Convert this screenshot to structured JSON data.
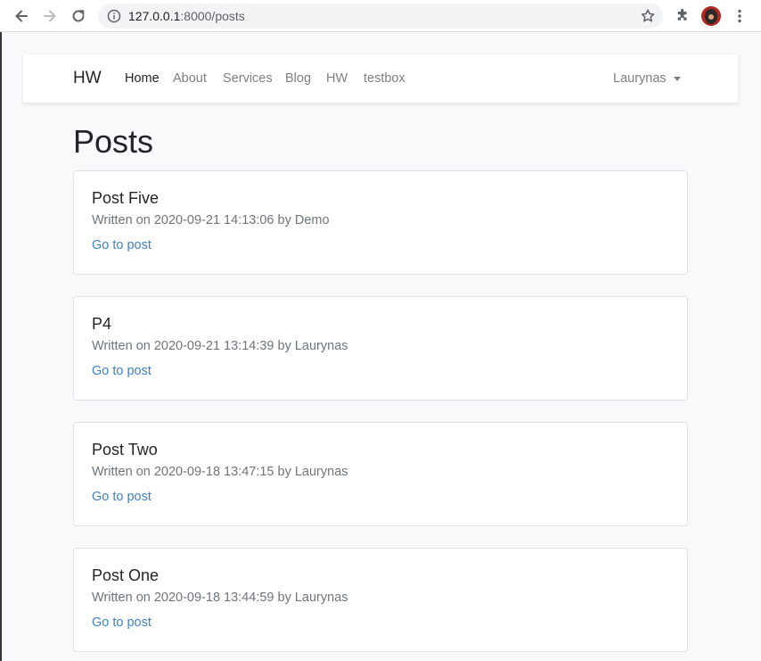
{
  "browser": {
    "url_host": "127.0.0.1",
    "url_rest": ":8000/posts"
  },
  "navbar": {
    "brand": "HW",
    "links": [
      {
        "label": "Home"
      },
      {
        "label": "About"
      },
      {
        "label": "Services"
      },
      {
        "label": "Blog"
      },
      {
        "label": "HW"
      },
      {
        "label": "testbox"
      }
    ],
    "user": "Laurynas"
  },
  "page": {
    "title": "Posts"
  },
  "posts": [
    {
      "title": "Post Five",
      "meta": "Written on 2020-09-21 14:13:06 by Demo",
      "link": "Go to post"
    },
    {
      "title": "P4",
      "meta": "Written on 2020-09-21 13:14:39 by Laurynas",
      "link": "Go to post"
    },
    {
      "title": "Post Two",
      "meta": "Written on 2020-09-18 13:47:15 by Laurynas",
      "link": "Go to post"
    },
    {
      "title": "Post One",
      "meta": "Written on 2020-09-18 13:44:59 by Laurynas",
      "link": "Go to post"
    }
  ],
  "colors": {
    "link": "#3f80c8",
    "muted": "#6c757d",
    "background": "#f8f9fa"
  },
  "icons": [
    "back-arrow-icon",
    "forward-arrow-icon",
    "reload-icon",
    "info-icon",
    "star-icon",
    "extensions-icon",
    "more-vertical-icon"
  ]
}
